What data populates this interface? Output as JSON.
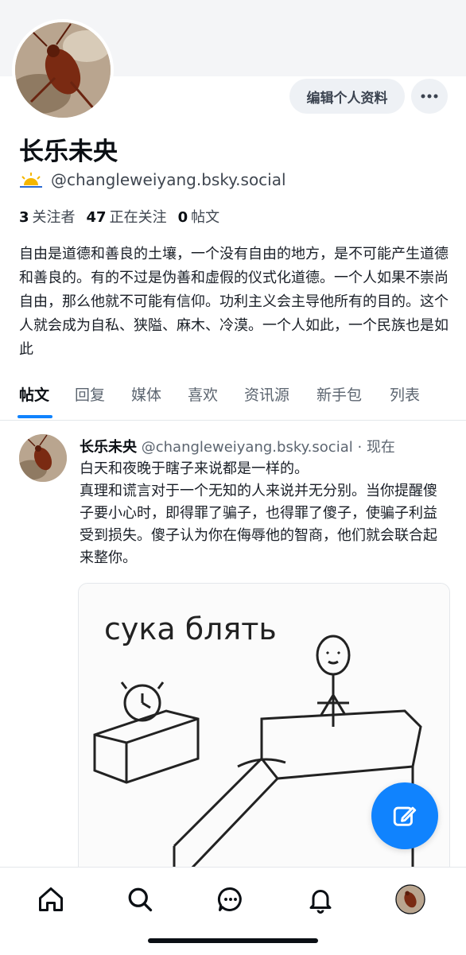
{
  "profile": {
    "display_name": "长乐未央",
    "handle": "@changleweiyang.bsky.social",
    "followers_count": "3",
    "followers_label": "关注者",
    "following_count": "47",
    "following_label": "正在关注",
    "posts_count": "0",
    "posts_label": "帖文",
    "bio": "自由是道德和善良的土壤，一个没有自由的地方，是不可能产生道德和善良的。有的不过是伪善和虚假的仪式化道德。一个人如果不崇尚自由，那么他就不可能有信仰。功利主义会主导他所有的目的。这个人就会成为自私、狭隘、麻木、冷漠。一个人如此，一个民族也是如此",
    "edit_label": "编辑个人资料",
    "more_icon": "more-horizontal-icon",
    "handle_icon": "sun-icon"
  },
  "tabs": [
    "帖文",
    "回复",
    "媒体",
    "喜欢",
    "资讯源",
    "新手包",
    "列表"
  ],
  "active_tab": 0,
  "post": {
    "author": "长乐未央",
    "handle": "@changleweiyang.bsky.social",
    "separator": "·",
    "time": "现在",
    "text_line1": "白天和夜晚于瞎子来说都是一样的。",
    "text_body": "真理和谎言对于一个无知的人来说并无分别。当你提醒傻子要小心时，即得罪了骗子，也得罪了傻子，使骗子利益受到损失。傻子认为你在侮辱他的智商，他们就会联合起来整你。",
    "image_caption_text": "сука блять"
  },
  "nav": [
    "home-icon",
    "search-icon",
    "chat-icon",
    "bell-icon",
    "profile-avatar"
  ],
  "colors": {
    "accent": "#1083fe",
    "banner": "#f4f5f7",
    "button_bg": "#eef1f5",
    "muted_text": "#5c6570"
  }
}
